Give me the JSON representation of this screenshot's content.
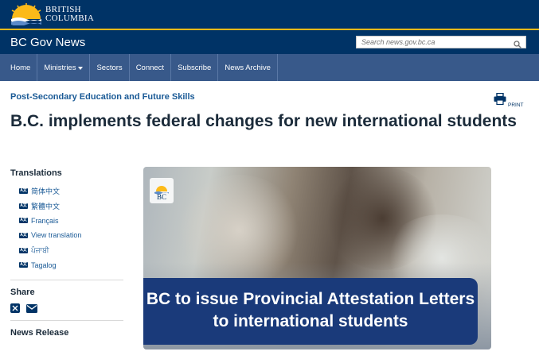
{
  "header": {
    "logo_line1": "BRITISH",
    "logo_line2": "COLUMBIA",
    "site_title": "BC Gov News",
    "search_placeholder": "Search news.gov.bc.ca"
  },
  "nav": {
    "items": [
      {
        "label": "Home"
      },
      {
        "label": "Ministries"
      },
      {
        "label": "Sectors"
      },
      {
        "label": "Connect"
      },
      {
        "label": "Subscribe"
      },
      {
        "label": "News Archive"
      }
    ]
  },
  "article": {
    "ministry": "Post-Secondary Education and Future Skills",
    "print_label": "PRINT",
    "headline": "B.C. implements federal changes for new international students",
    "image_caption": "BC to issue Provincial Attestation Letters to international students",
    "image_badge": "BC"
  },
  "sidebar": {
    "translations_heading": "Translations",
    "translation_icon_text": "A文",
    "translations": [
      {
        "label": "简体中文"
      },
      {
        "label": "繁體中文"
      },
      {
        "label": "Français"
      },
      {
        "label": "View translation"
      },
      {
        "label": "ਪੰਜਾਬੀ"
      },
      {
        "label": "Tagalog"
      }
    ],
    "share_heading": "Share",
    "news_release_heading": "News Release"
  },
  "colors": {
    "header_bg": "#003366",
    "nav_bg": "#38598a",
    "accent_gold": "#fcba19",
    "link_blue": "#1a5a96",
    "caption_bg": "#1a3a7a"
  },
  "icons": [
    "bc-sun-logo",
    "search-icon",
    "print-icon",
    "translate-icon",
    "x-icon",
    "email-icon"
  ]
}
